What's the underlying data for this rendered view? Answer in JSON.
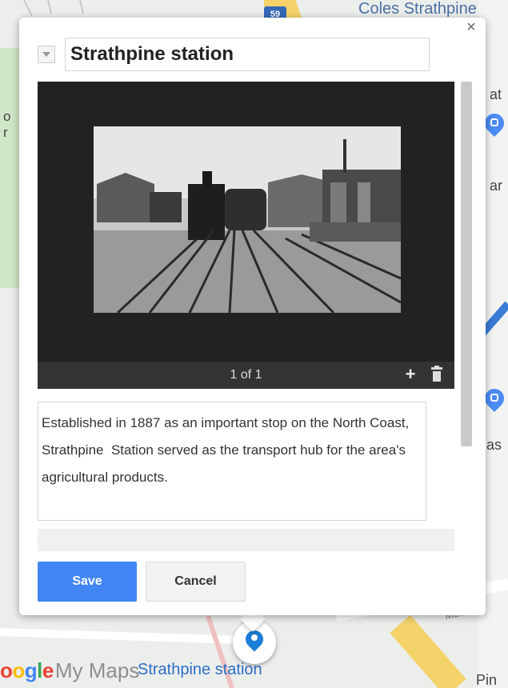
{
  "map": {
    "labels": {
      "top_right": "Coles Strathpine",
      "side_1": "at",
      "side_2": "ar",
      "side_3": "as",
      "bottom_right": "Pin",
      "street": "McMullen",
      "left_1": "o",
      "left_2": "r"
    },
    "road_shield": "59",
    "branding": {
      "google": "Google",
      "my_maps": "My Maps",
      "station_label": "Strathpine station"
    }
  },
  "info_window": {
    "close_label": "×",
    "title_value": "Strathpine station",
    "media": {
      "counter": "1 of 1",
      "add_label": "+"
    },
    "description": "Established in 1887 as an important stop on the North Coast, Strathpine  Station served as the transport hub for the area's agricultural products.",
    "buttons": {
      "save": "Save",
      "cancel": "Cancel"
    }
  },
  "colors": {
    "accent": "#4285f4",
    "marker": "#1c7ed6",
    "viewer_bg": "#222222"
  }
}
